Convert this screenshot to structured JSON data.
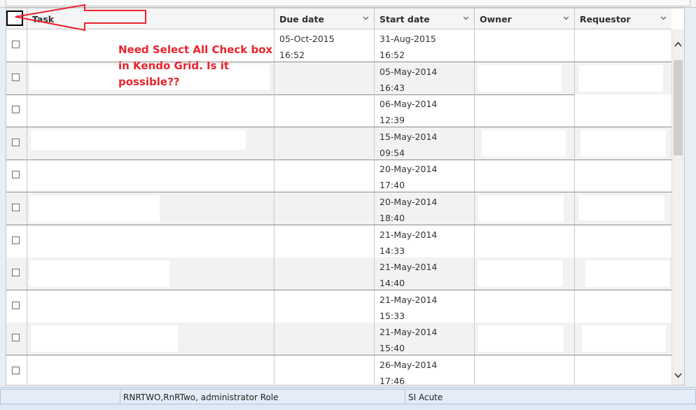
{
  "grid": {
    "columns": [
      {
        "label": ""
      },
      {
        "label": "Task"
      },
      {
        "label": "Due date"
      },
      {
        "label": "Start date"
      },
      {
        "label": "Owner"
      },
      {
        "label": "Requestor"
      }
    ],
    "rows": [
      {
        "due_date": "05-Oct-2015",
        "due_time": "16:52",
        "start_date": "31-Aug-2015",
        "start_time": "16:52"
      },
      {
        "due_date": "",
        "due_time": "",
        "start_date": "05-May-2014",
        "start_time": "16:43"
      },
      {
        "due_date": "",
        "due_time": "",
        "start_date": "06-May-2014",
        "start_time": "12:39"
      },
      {
        "due_date": "",
        "due_time": "",
        "start_date": "15-May-2014",
        "start_time": "09:54"
      },
      {
        "due_date": "",
        "due_time": "",
        "start_date": "20-May-2014",
        "start_time": "17:40"
      },
      {
        "due_date": "",
        "due_time": "",
        "start_date": "20-May-2014",
        "start_time": "18:40"
      },
      {
        "due_date": "",
        "due_time": "",
        "start_date": "21-May-2014",
        "start_time": "14:33"
      },
      {
        "due_date": "",
        "due_time": "",
        "start_date": "21-May-2014",
        "start_time": "14:40"
      },
      {
        "due_date": "",
        "due_time": "",
        "start_date": "21-May-2014",
        "start_time": "15:33"
      },
      {
        "due_date": "",
        "due_time": "",
        "start_date": "21-May-2014",
        "start_time": "15:40"
      },
      {
        "due_date": "",
        "due_time": "",
        "start_date": "26-May-2014",
        "start_time": "17:46"
      }
    ]
  },
  "annotation": {
    "line1": "Need Select All Check box",
    "line2": "in Kendo Grid. Is it",
    "line3": "possible??",
    "color": "#e8242e"
  },
  "statusbar": {
    "user": "RNRTWO,RnRTwo, administrator Role",
    "unit": "SI Acute"
  },
  "icons": {
    "sort": "chevron-down-icon",
    "scroll_up": "chevron-up-icon",
    "scroll_down": "chevron-down-icon",
    "arrow": "arrow-left-icon"
  }
}
